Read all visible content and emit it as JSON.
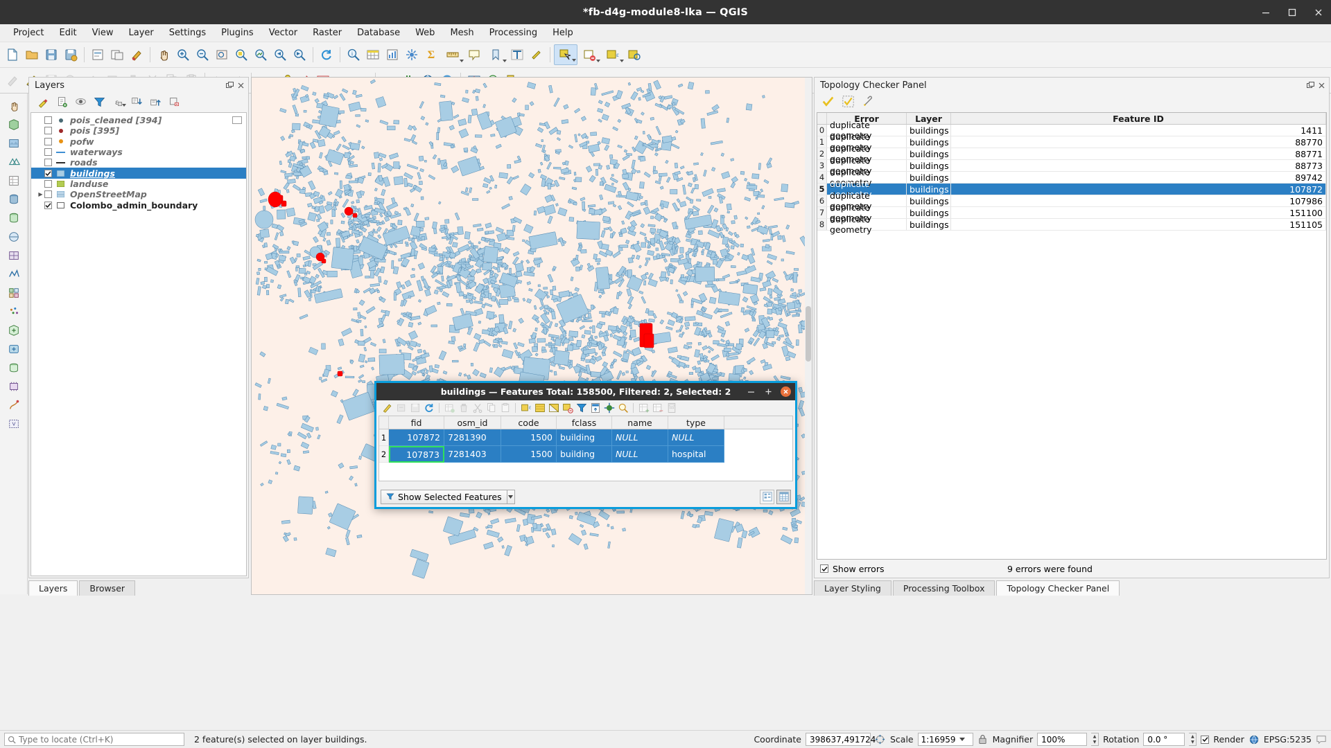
{
  "window": {
    "title": "*fb-d4g-module8-lka — QGIS",
    "buttons": {
      "minimize": "minimize-button",
      "maximize": "maximize-button",
      "close": "close-button"
    }
  },
  "menu": {
    "items": [
      "Project",
      "Edit",
      "View",
      "Layer",
      "Settings",
      "Plugins",
      "Vector",
      "Raster",
      "Database",
      "Web",
      "Mesh",
      "Processing",
      "Help"
    ]
  },
  "layers_panel": {
    "title": "Layers",
    "toolbar_icons": [
      "open-layer-styling-icon",
      "add-group-icon",
      "manage-layer-visibility-icon",
      "filter-legend-icon",
      "filter-legend-expression-icon",
      "expand-all-icon",
      "collapse-all-icon",
      "remove-layer-icon"
    ],
    "items": [
      {
        "label": "pois_cleaned [394]",
        "checked": false,
        "symbol": "point",
        "color": "#4a6b75",
        "expandable": false,
        "selected": false
      },
      {
        "label": "pois [395]",
        "checked": false,
        "symbol": "point",
        "color": "#9e2a2a",
        "expandable": false,
        "selected": false
      },
      {
        "label": "pofw",
        "checked": false,
        "symbol": "point",
        "color": "#e89213",
        "expandable": false,
        "selected": false
      },
      {
        "label": "waterways",
        "checked": false,
        "symbol": "line",
        "color": "#3f8fd4",
        "expandable": false,
        "selected": false
      },
      {
        "label": "roads",
        "checked": false,
        "symbol": "line",
        "color": "#2d2d2d",
        "expandable": false,
        "selected": false
      },
      {
        "label": "buildings",
        "checked": true,
        "symbol": "polygon",
        "color": "#a8cde4",
        "expandable": false,
        "selected": true
      },
      {
        "label": "landuse",
        "checked": false,
        "symbol": "polygon",
        "color": "#b3cc52",
        "expandable": false,
        "selected": false
      },
      {
        "label": "OpenStreetMap",
        "checked": false,
        "symbol": "raster",
        "color": "#bcd6e8",
        "expandable": true,
        "selected": false
      },
      {
        "label": "Colombo_admin_boundary",
        "checked": true,
        "symbol": "polygon",
        "color": "#ffffff",
        "expandable": false,
        "selected": false
      }
    ],
    "tabs": [
      {
        "label": "Layers",
        "active": true
      },
      {
        "label": "Browser",
        "active": false
      }
    ]
  },
  "topology_panel": {
    "title": "Topology Checker Panel",
    "toolbar_icons": [
      "validate-all-icon",
      "validate-extent-icon",
      "configure-icon"
    ],
    "columns": [
      "Error",
      "Layer",
      "Feature ID"
    ],
    "rows": [
      {
        "index": "0",
        "error": "duplicate geometry",
        "layer": "buildings",
        "feature_id": "1411",
        "selected": false
      },
      {
        "index": "1",
        "error": "duplicate geometry",
        "layer": "buildings",
        "feature_id": "88770",
        "selected": false
      },
      {
        "index": "2",
        "error": "duplicate geometry",
        "layer": "buildings",
        "feature_id": "88771",
        "selected": false
      },
      {
        "index": "3",
        "error": "duplicate geometry",
        "layer": "buildings",
        "feature_id": "88773",
        "selected": false
      },
      {
        "index": "4",
        "error": "duplicate geometry",
        "layer": "buildings",
        "feature_id": "89742",
        "selected": false
      },
      {
        "index": "5",
        "error": "duplicate geometry",
        "layer": "buildings",
        "feature_id": "107872",
        "selected": true
      },
      {
        "index": "6",
        "error": "duplicate geometry",
        "layer": "buildings",
        "feature_id": "107986",
        "selected": false
      },
      {
        "index": "7",
        "error": "duplicate geometry",
        "layer": "buildings",
        "feature_id": "151100",
        "selected": false
      },
      {
        "index": "8",
        "error": "duplicate geometry",
        "layer": "buildings",
        "feature_id": "151105",
        "selected": false
      }
    ],
    "show_errors_label": "Show errors",
    "show_errors_checked": true,
    "status": "9 errors were found",
    "tabs": [
      {
        "label": "Layer Styling",
        "active": false
      },
      {
        "label": "Processing Toolbox",
        "active": false
      },
      {
        "label": "Topology Checker Panel",
        "active": true
      }
    ]
  },
  "attribute_dialog": {
    "title": "buildings — Features Total: 158500, Filtered: 2, Selected: 2",
    "toolbar_icons": [
      "toggle-editing-icon",
      "save-edits-icon",
      "reload-table-icon",
      "refresh-icon",
      "new-feature-icon",
      "delete-selected-icon",
      "cut-features-icon",
      "copy-features-icon",
      "paste-features-icon",
      "select-by-expression-icon",
      "select-all-icon",
      "invert-selection-icon",
      "deselect-all-icon",
      "filter-features-icon",
      "move-selection-to-top-icon",
      "pan-map-to-feature-icon",
      "zoom-to-selection-icon",
      "new-field-icon",
      "delete-field-icon",
      "field-calculator-icon",
      "conditional-formatting-icon",
      "actions-icon",
      "form-view-icon"
    ],
    "columns": [
      "fid",
      "osm_id",
      "code",
      "fclass",
      "name",
      "type"
    ],
    "rows": [
      {
        "index": "1",
        "fid": "107872",
        "osm_id": "7281390",
        "code": "1500",
        "fclass": "building",
        "name": "NULL",
        "type": "NULL",
        "selected": true,
        "edited": false
      },
      {
        "index": "2",
        "fid": "107873",
        "osm_id": "7281403",
        "code": "1500",
        "fclass": "building",
        "name": "NULL",
        "type": "hospital",
        "selected": true,
        "edited": true
      }
    ],
    "show_selected_button": "Show Selected Features",
    "footer_icons": [
      "table-view-icon",
      "form-view-icon"
    ]
  },
  "statusbar": {
    "locator_placeholder": "Type to locate (Ctrl+K)",
    "message": "2 feature(s) selected on layer buildings.",
    "coordinate_label": "Coordinate",
    "coordinate_value": "398637,491724",
    "scale_label": "Scale",
    "scale_value": "1:16959",
    "magnifier_label": "Magnifier",
    "magnifier_value": "100%",
    "rotation_label": "Rotation",
    "rotation_value": "0.0 °",
    "render_label": "Render",
    "render_checked": true,
    "crs_value": "EPSG:5235"
  },
  "colors": {
    "selection_blue": "#2b7fc4",
    "dialog_border": "#0a9ddc",
    "map_background": "#fdf0e8",
    "building_fill": "#a8cde4",
    "building_stroke": "#4a7fa5",
    "highlight_red": "#ff0000",
    "titlebar": "#333333"
  }
}
